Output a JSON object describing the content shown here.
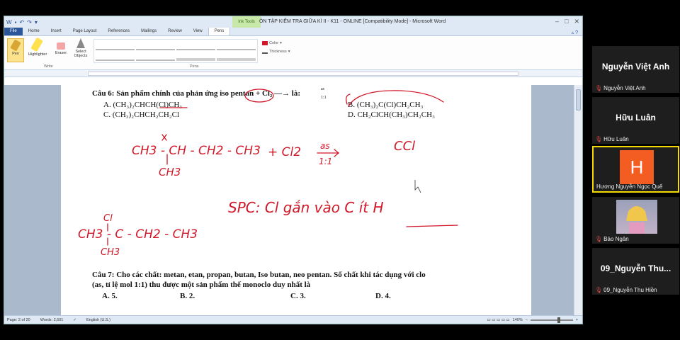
{
  "window": {
    "title": "ÔN TẬP KIỂM TRA GIỮA KÌ II - K11 - ONLINE [Compatibility Mode] - Microsoft Word",
    "context_tab": "Ink Tools"
  },
  "tabs": [
    "File",
    "Home",
    "Insert",
    "Page Layout",
    "References",
    "Mailings",
    "Review",
    "View",
    "Pens"
  ],
  "ribbon": {
    "pen": "Pen",
    "highlighter": "Highlighter",
    "eraser": "Eraser",
    "select_objects": "Select Objects",
    "group_write": "Write",
    "group_pens": "Pens",
    "color": "Color",
    "thickness": "Thickness"
  },
  "document": {
    "q6": "Câu 6: Sản phẩm chính của phản ứng iso pentan + Cl₂ —→ là:",
    "q6_arrow_top": "as",
    "q6_arrow_bottom": "1:1",
    "q6_a": "A. (CH₃)₂CHCH(Cl)CH₃",
    "q6_b": "B. (CH₃)₂C(Cl)CH₂CH₃",
    "q6_c": "C. (CH₃)₂CHCH₂CH₂Cl",
    "q6_d": "D. CH₂ClCH(CH₃)CH₂CH₃",
    "q7_line1": "Câu 7: Cho các chất: metan, etan, propan, butan, Iso butan, neo pentan. Số chất khi tác dụng với clo",
    "q7_line2": "(as, tỉ lệ mol 1:1) thu được một sản phẩm thế monoclo duy nhất là",
    "q7_a": "A. 5.",
    "q7_b": "B. 2.",
    "q7_c": "C. 3.",
    "q7_d": "D. 4."
  },
  "handwriting": {
    "reactant": "CH3 - CH - CH2 - CH3",
    "reactant_branch": "CH3",
    "plus_cl2": "+ Cl2",
    "cond_top": "as",
    "cond_bottom": "1:1",
    "ccl": "CCl",
    "spc": "SPC: Cl gắn vào C ít H",
    "product": "CH3 - C - CH2 - CH3",
    "product_top": "Cl",
    "product_bottom": "CH3",
    "ink_color": "#d0182a"
  },
  "status": {
    "page": "Page: 2 of 20",
    "words": "Words: 2,601",
    "language": "English (U.S.)",
    "zoom": "140%"
  },
  "participants": [
    {
      "display": "Nguyễn Việt Anh",
      "caption": "Nguyễn Việt Anh"
    },
    {
      "display": "Hữu Luân",
      "caption": "Hữu Luân"
    },
    {
      "initial": "H",
      "caption": "Hương Nguyễn Ngọc Quế"
    },
    {
      "caption": "Bảo Ngân"
    },
    {
      "display": "09_Nguyễn Thu...",
      "caption": "09_Nguyễn Thu Hiền"
    }
  ]
}
